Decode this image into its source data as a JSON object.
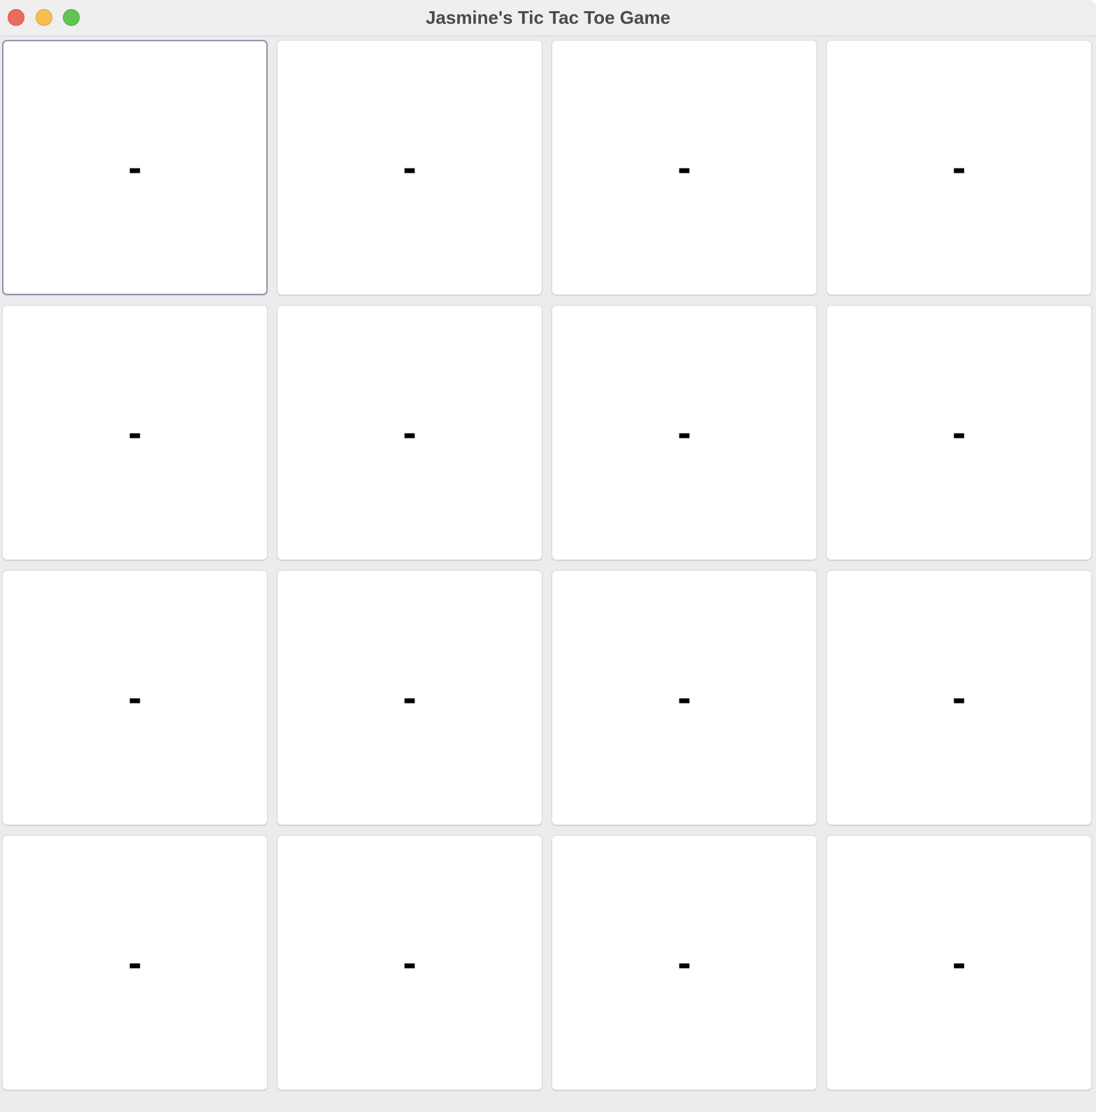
{
  "window": {
    "title": "Jasmine's Tic Tac Toe Game",
    "controls": {
      "close": "close-window",
      "minimize": "minimize-window",
      "zoom": "zoom-window"
    }
  },
  "board": {
    "rows": 4,
    "columns": 4,
    "focused_cell": 0,
    "cells": [
      "-",
      "-",
      "-",
      "-",
      "-",
      "-",
      "-",
      "-",
      "-",
      "-",
      "-",
      "-",
      "-",
      "-",
      "-",
      "-"
    ]
  }
}
